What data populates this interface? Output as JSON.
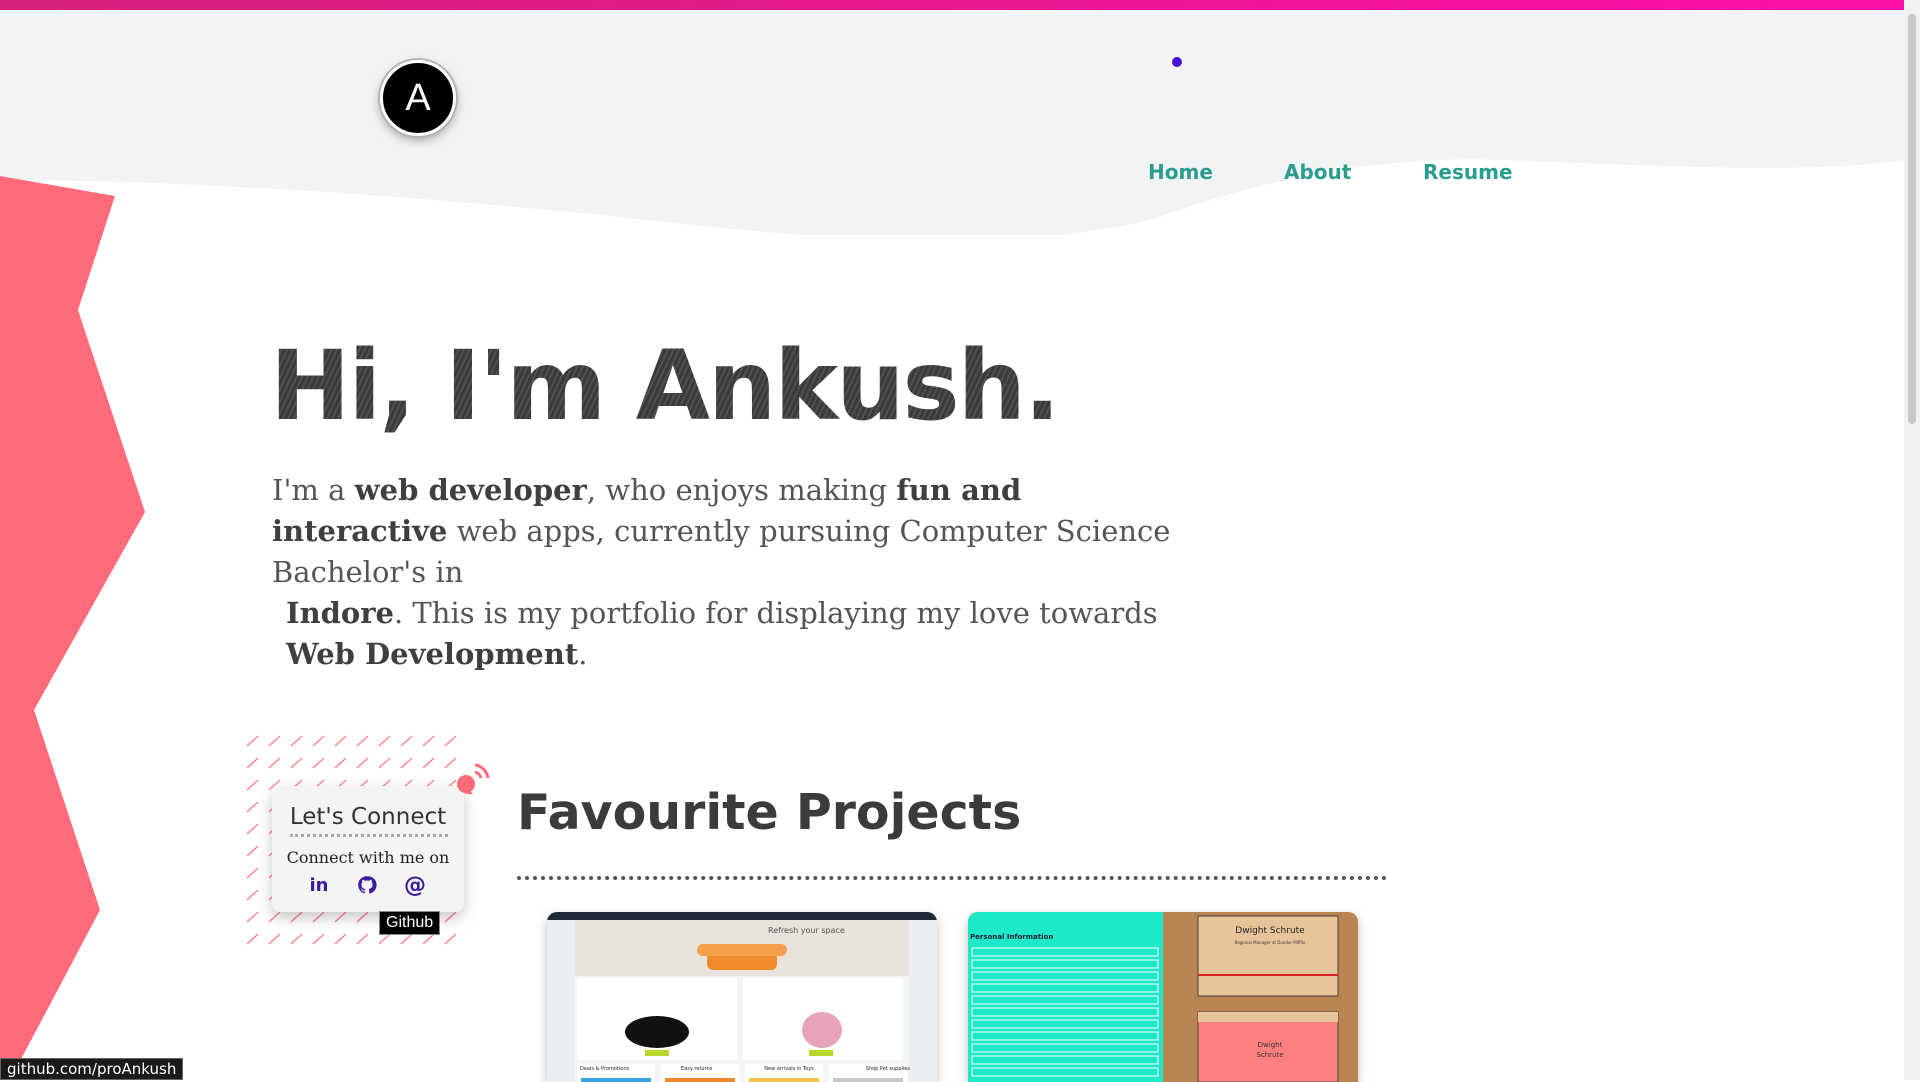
{
  "header": {
    "logo_letter": "A",
    "nav": [
      {
        "label": "Home",
        "active": true
      },
      {
        "label": "About"
      },
      {
        "label": "Resume"
      }
    ]
  },
  "hero": {
    "title": "Hi, I'm Ankush.",
    "intro": {
      "p1": "I'm a ",
      "b1": "web developer",
      "p2": ", who enjoys making ",
      "b2": "fun and interactive",
      "p3": " web apps, currently pursuing Computer Science Bachelor's in ",
      "b3": "Indore",
      "p4": ". This is my portfolio for displaying my love towards ",
      "b4": "Web Development",
      "p5": "."
    }
  },
  "connect": {
    "title": "Let's Connect",
    "subtitle": "Connect with me on",
    "icons": [
      "linkedin-icon",
      "github-icon",
      "at-sign-icon"
    ],
    "tooltip": "Github"
  },
  "projects": {
    "title": "Favourite Projects",
    "cards": [
      {
        "banner": "Refresh your space",
        "sections": [
          "Deals & Promotions",
          "Easy returns",
          "New arrivals in Toys",
          "Shop Pet supplies"
        ]
      },
      {
        "form_title": "Personal Information",
        "card_name": "Dwight Schrute",
        "card_role": "Regional Manager at Dunder Mifflin",
        "back_name_1": "Dwight",
        "back_name_2": "Schrute"
      }
    ]
  },
  "status_url": "github.com/proAnkush",
  "colors": {
    "accent_bar": "#ff0fa8",
    "nav_link": "#2a9d8f",
    "left_shape": "#ff6b7a",
    "nav_dot": "#4b0ed8"
  }
}
